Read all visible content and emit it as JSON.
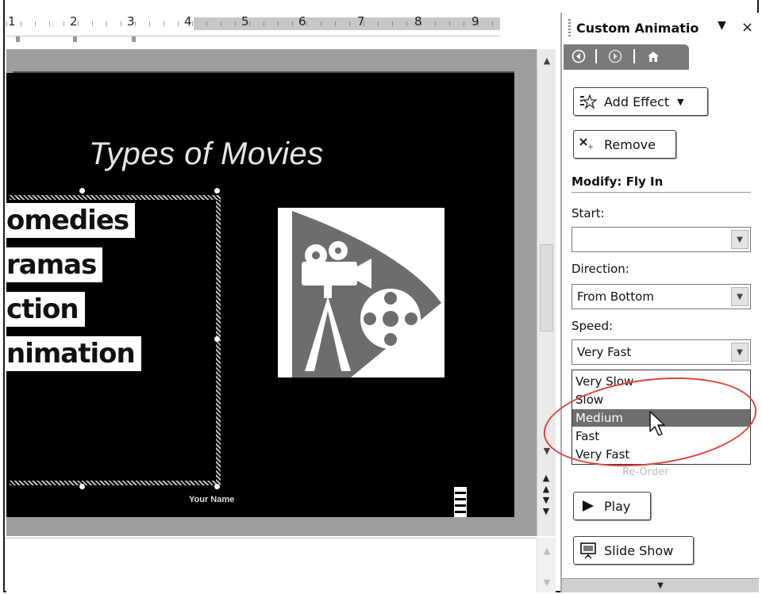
{
  "ruler": {
    "numbers": [
      "1",
      "2",
      "3",
      "4",
      "5",
      "6",
      "7",
      "8",
      "9"
    ]
  },
  "slide": {
    "title": "Types of Movies",
    "bullets": [
      "omedies",
      "ramas",
      "ction",
      "nimation"
    ],
    "footer_name": "Your Name",
    "clipart": "movie-camera-film-reel-clipart"
  },
  "task_pane": {
    "title": "Custom Animatio",
    "menu_glyph": "▼",
    "close_glyph": "×",
    "add_effect_label": "Add Effect",
    "remove_label": "Remove",
    "modify_label": "Modify: Fly In",
    "start_label": "Start:",
    "start_value": "",
    "direction_label": "Direction:",
    "direction_value": "From Bottom",
    "speed_label": "Speed:",
    "speed_value": "Very Fast",
    "speed_options": [
      "Very Slow",
      "Slow",
      "Medium",
      "Fast",
      "Very Fast"
    ],
    "speed_highlighted": "Medium",
    "reorder_label": "Re-Order",
    "play_label": "Play",
    "slide_show_label": "Slide Show"
  },
  "colors": {
    "accent_highlight": "#6e6e6e",
    "annotation": "#e0443a",
    "slide_background": "#000000"
  },
  "icons": {
    "nav_back": "back-arrow-icon",
    "nav_forward": "forward-arrow-icon",
    "nav_home": "home-icon",
    "add_effect": "star-effect-icon",
    "remove": "remove-x-icon",
    "play": "play-triangle-icon",
    "slide_show": "slide-show-screen-icon"
  }
}
